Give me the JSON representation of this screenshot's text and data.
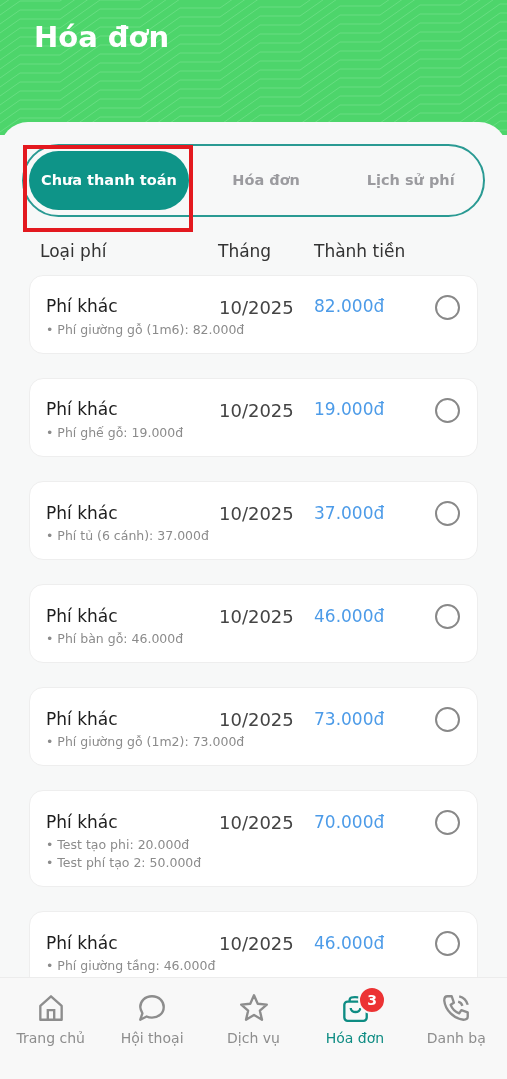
{
  "header": {
    "title": "Hóa đơn"
  },
  "tabs": [
    {
      "label": "Chưa thanh toán",
      "selected": true,
      "highlighted": true
    },
    {
      "label": "Hóa đơn",
      "selected": false,
      "highlighted": false
    },
    {
      "label": "Lịch sử phí",
      "selected": false,
      "highlighted": false
    }
  ],
  "table": {
    "columns": [
      "Loại phí",
      "Tháng",
      "Thành tiền"
    ],
    "rows": [
      {
        "type": "Phí khác",
        "month": "10/2025",
        "amount": "82.000đ",
        "details": [
          "• Phí giường gỗ (1m6): 82.000đ"
        ],
        "checked": false
      },
      {
        "type": "Phí khác",
        "month": "10/2025",
        "amount": "19.000đ",
        "details": [
          "• Phí ghế gỗ: 19.000đ"
        ],
        "checked": false
      },
      {
        "type": "Phí khác",
        "month": "10/2025",
        "amount": "37.000đ",
        "details": [
          "• Phí tủ (6 cánh): 37.000đ"
        ],
        "checked": false
      },
      {
        "type": "Phí khác",
        "month": "10/2025",
        "amount": "46.000đ",
        "details": [
          "• Phí bàn gỗ: 46.000đ"
        ],
        "checked": false
      },
      {
        "type": "Phí khác",
        "month": "10/2025",
        "amount": "73.000đ",
        "details": [
          "• Phí giường gỗ (1m2): 73.000đ"
        ],
        "checked": false
      },
      {
        "type": "Phí khác",
        "month": "10/2025",
        "amount": "70.000đ",
        "details": [
          "• Test tạo phi: 20.000đ",
          "• Test phí tạo 2: 50.000đ"
        ],
        "checked": false
      },
      {
        "type": "Phí khác",
        "month": "10/2025",
        "amount": "46.000đ",
        "details": [
          "• Phí giường tầng: 46.000đ"
        ],
        "checked": false
      }
    ]
  },
  "bottom_nav": [
    {
      "kind": "home",
      "label": "Trang chủ",
      "selected": false
    },
    {
      "kind": "chat",
      "label": "Hội thoại",
      "selected": false
    },
    {
      "kind": "star",
      "label": "Dịch vụ",
      "selected": false
    },
    {
      "kind": "bag",
      "label": "Hóa đơn",
      "selected": true,
      "badge": "3"
    },
    {
      "kind": "phone",
      "label": "Danh bạ",
      "selected": false
    }
  ]
}
